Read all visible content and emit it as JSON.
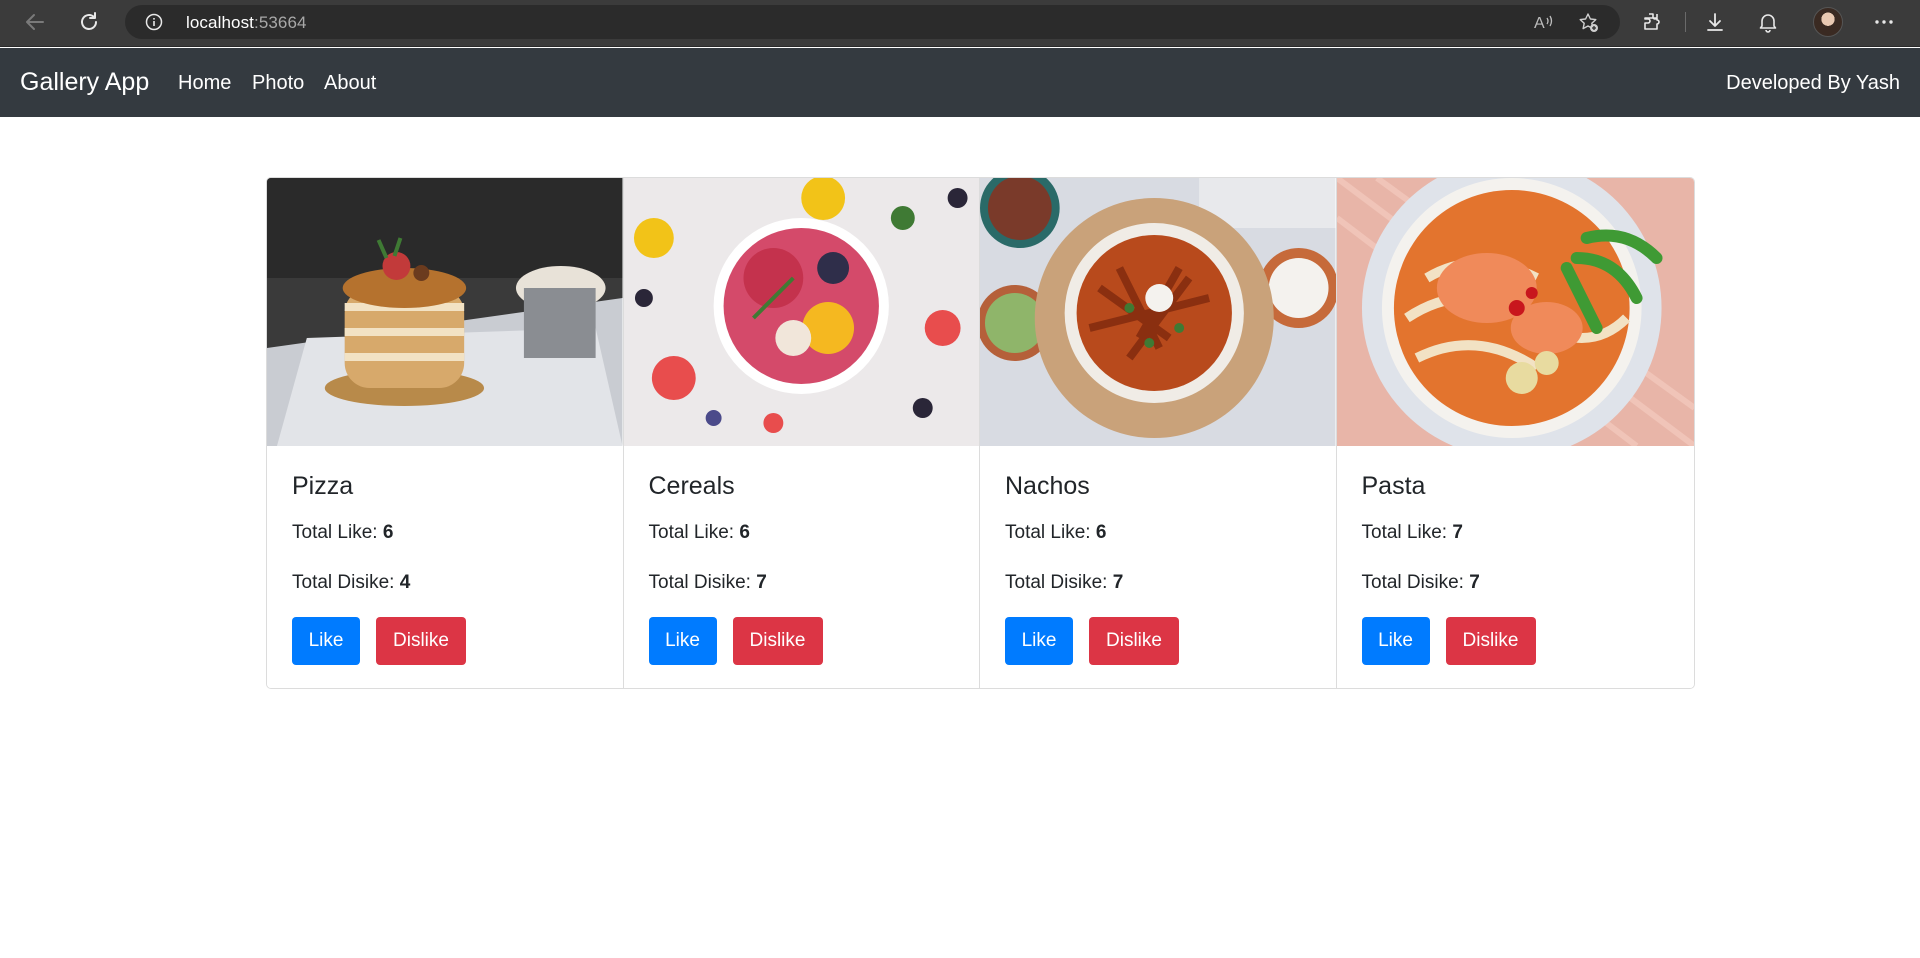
{
  "browser": {
    "url_host": "localhost",
    "url_port": ":53664"
  },
  "navbar": {
    "brand": "Gallery App",
    "links": [
      "Home",
      "Photo",
      "About"
    ],
    "right_text": "Developed By Yash"
  },
  "cards": [
    {
      "title": "Pizza",
      "like_label": "Total Like:",
      "likes": "6",
      "dislike_label": "Total Disike:",
      "dislikes": "4",
      "like_button": "Like",
      "dislike_button": "Dislike"
    },
    {
      "title": "Cereals",
      "like_label": "Total Like:",
      "likes": "6",
      "dislike_label": "Total Disike:",
      "dislikes": "7",
      "like_button": "Like",
      "dislike_button": "Dislike"
    },
    {
      "title": "Nachos",
      "like_label": "Total Like:",
      "likes": "6",
      "dislike_label": "Total Disike:",
      "dislikes": "7",
      "like_button": "Like",
      "dislike_button": "Dislike"
    },
    {
      "title": "Pasta",
      "like_label": "Total Like:",
      "likes": "7",
      "dislike_label": "Total Disike:",
      "dislikes": "7",
      "like_button": "Like",
      "dislike_button": "Dislike"
    }
  ],
  "colors": {
    "navbar_bg": "#343a40",
    "like_button": "#007bff",
    "dislike_button": "#dc3545",
    "browser_bar": "#3b3b3b"
  },
  "icons": [
    "back-icon",
    "refresh-icon",
    "info-icon",
    "read-aloud-icon",
    "favorite-icon",
    "extensions-icon",
    "download-icon",
    "notifications-icon",
    "profile-avatar",
    "more-icon"
  ]
}
